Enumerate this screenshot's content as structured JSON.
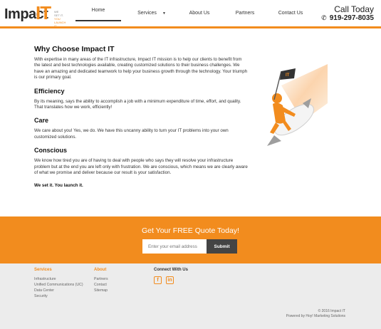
{
  "header": {
    "logo": {
      "word": "Impact",
      "it": "IT",
      "tagline": [
        "WE",
        "SET IT.",
        "YOU",
        "LAUNCH",
        "IT."
      ]
    },
    "nav": [
      {
        "label": "Home"
      },
      {
        "label": "Services",
        "caret": "▼"
      },
      {
        "label": "About Us"
      },
      {
        "label": "Partners"
      },
      {
        "label": "Contact Us"
      }
    ],
    "call": {
      "title": "Call Today",
      "phone": "919-297-8035",
      "phone_icon": "phone-icon"
    }
  },
  "main": {
    "title": "Why Choose Impact IT",
    "intro": "With expertise in many areas of the IT infrastructure, Impact IT mission is to help our clients to benefit from the latest and best technologies available, creating customized solutions to their business challenges. We have an amazing and dedicated teamwork to help your business growth through the technology. Your triumph is our primary goal.",
    "sections": [
      {
        "heading": "Efficiency",
        "text": "By its meaning, says the ability to accomplish a job with a minimum expenditure of time, effort, and quality. That translates how we work, efficiently!"
      },
      {
        "heading": "Care",
        "text": "We care about you! Yes, we do. We have this uncanny ability to turn your IT problems into your own customized solutions."
      },
      {
        "heading": "Conscious",
        "text": "We know how tired you are of having to deal with people who says they will resolve your infrastructure problem but at the end you are left only with frustration. We are conscious, which means we are clearly aware of what we promise and deliver because our result is your satisfaction."
      }
    ],
    "tagline": "We set it. You launch it.",
    "mascot_flag": "IT"
  },
  "quote": {
    "title": "Get Your FREE Quote Today!",
    "email_placeholder": "Enter your email address",
    "submit_label": "Submit"
  },
  "footer": {
    "services": {
      "heading": "Services",
      "links": [
        "Infrastructure",
        "Unified Communications (UC)",
        "Data Center",
        "Security"
      ]
    },
    "about": {
      "heading": "About",
      "links": [
        "Partners",
        "Contact",
        "Sitemap"
      ]
    },
    "connect": {
      "heading": "Connect With Us",
      "icons": [
        "facebook-icon",
        "linkedin-icon"
      ],
      "facebook_glyph": "f",
      "linkedin_glyph": "in"
    },
    "copyright": "© 2016 Impact IT",
    "powered": "Powered by Hoy! Marketing Solutions"
  },
  "colors": {
    "accent": "#f28c1e",
    "dark": "#444444",
    "footer_bg": "#ececec"
  }
}
